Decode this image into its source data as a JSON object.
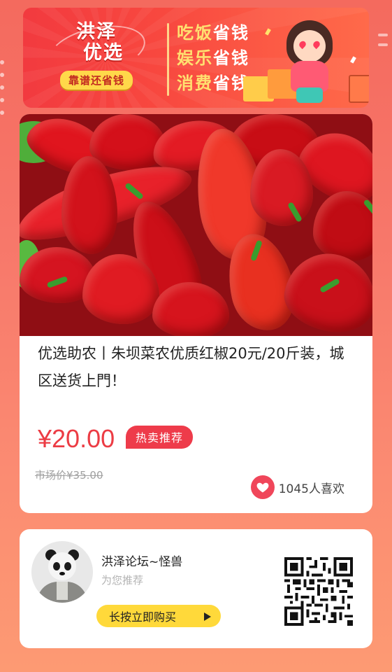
{
  "banner": {
    "logo_line1": "洪泽",
    "logo_line2": "优选",
    "logo_tag": "靠谱还省钱",
    "slogans": [
      {
        "hl": "吃饭",
        "rest": "省钱"
      },
      {
        "hl": "娱乐",
        "rest": "省钱"
      },
      {
        "hl": "消费",
        "rest": "省钱"
      }
    ]
  },
  "product": {
    "title": "优选助农丨朱坝菜农优质红椒20元/20斤装，城区送货上門！",
    "price": "¥20.00",
    "hot_badge": "热卖推荐",
    "market_price": "市场价¥35.00",
    "likes": "1045人喜欢"
  },
  "share": {
    "author": "洪泽论坛~怪兽",
    "recommend": "为您推荐",
    "buy_label": "长按立即购买"
  },
  "colors": {
    "accent_red": "#ec3c44",
    "badge_red": "#ee3b4a",
    "button_yellow": "#ffd93a"
  },
  "icons": {
    "likes": "heart-icon",
    "buy": "play-triangle-icon"
  }
}
